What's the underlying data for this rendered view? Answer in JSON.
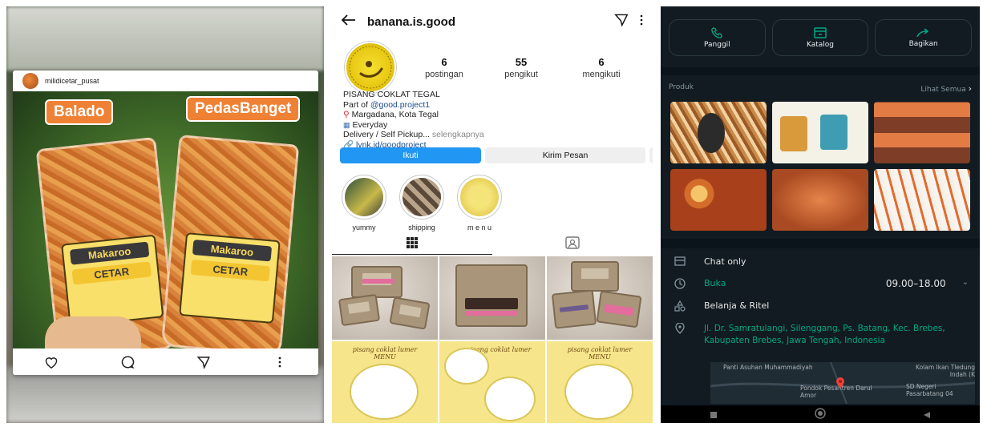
{
  "post": {
    "username": "milidicetar_pusat",
    "tag_left": "Balado",
    "tag_right": "PedasBanget",
    "product_name": "Makaroo",
    "product_brand": "CETAR",
    "actions": [
      "like-icon",
      "comment-icon",
      "share-icon",
      "more-icon"
    ]
  },
  "profile": {
    "username": "banana.is.good",
    "stats": [
      {
        "n": "6",
        "label": "postingan"
      },
      {
        "n": "55",
        "label": "pengikut"
      },
      {
        "n": "6",
        "label": "mengikuti"
      }
    ],
    "bio_name": "PISANG COKLAT TEGAL",
    "bio_part_of": "Part of",
    "bio_part_link": "@good.project1",
    "bio_location": "Margadana, Kota Tegal",
    "bio_schedule": "Everyday",
    "bio_delivery": "Delivery / Self Pickup...",
    "bio_more": "selengkapnya",
    "bio_link": "lynk.id/goodproject",
    "follow_label": "Ikuti",
    "message_label": "Kirim Pesan",
    "highlights": [
      {
        "label": "yummy"
      },
      {
        "label": "shipping"
      },
      {
        "label": "m e n u"
      }
    ],
    "grid_menu_title": "pisang coklat lumer",
    "grid_menu_sub": "MENU"
  },
  "business": {
    "actions": [
      {
        "label": "Panggil",
        "icon": "phone-icon"
      },
      {
        "label": "Katalog",
        "icon": "catalog-icon"
      },
      {
        "label": "Bagikan",
        "icon": "share-icon"
      }
    ],
    "products_label": "Produk",
    "see_all": "Lihat Semua",
    "chat_only": "Chat only",
    "open_label": "Buka",
    "hours": "09.00–18.00",
    "category": "Belanja & Ritel",
    "address": "Jl. Dr. Samratulangi, Silenggang, Ps. Batang, Kec. Brebes, Kabupaten Brebes, Jawa Tengah, Indonesia",
    "map_labels": {
      "a": "Panti Asuhan Muhammadiyah",
      "b": "Pondok Pesantren Darul Amor",
      "c": "SD Negeri Pasarbatang 04",
      "d": "Kolam Ikan Tledung Indah (K"
    },
    "colors": {
      "accent": "#00a884",
      "bg": "#111b21"
    }
  }
}
